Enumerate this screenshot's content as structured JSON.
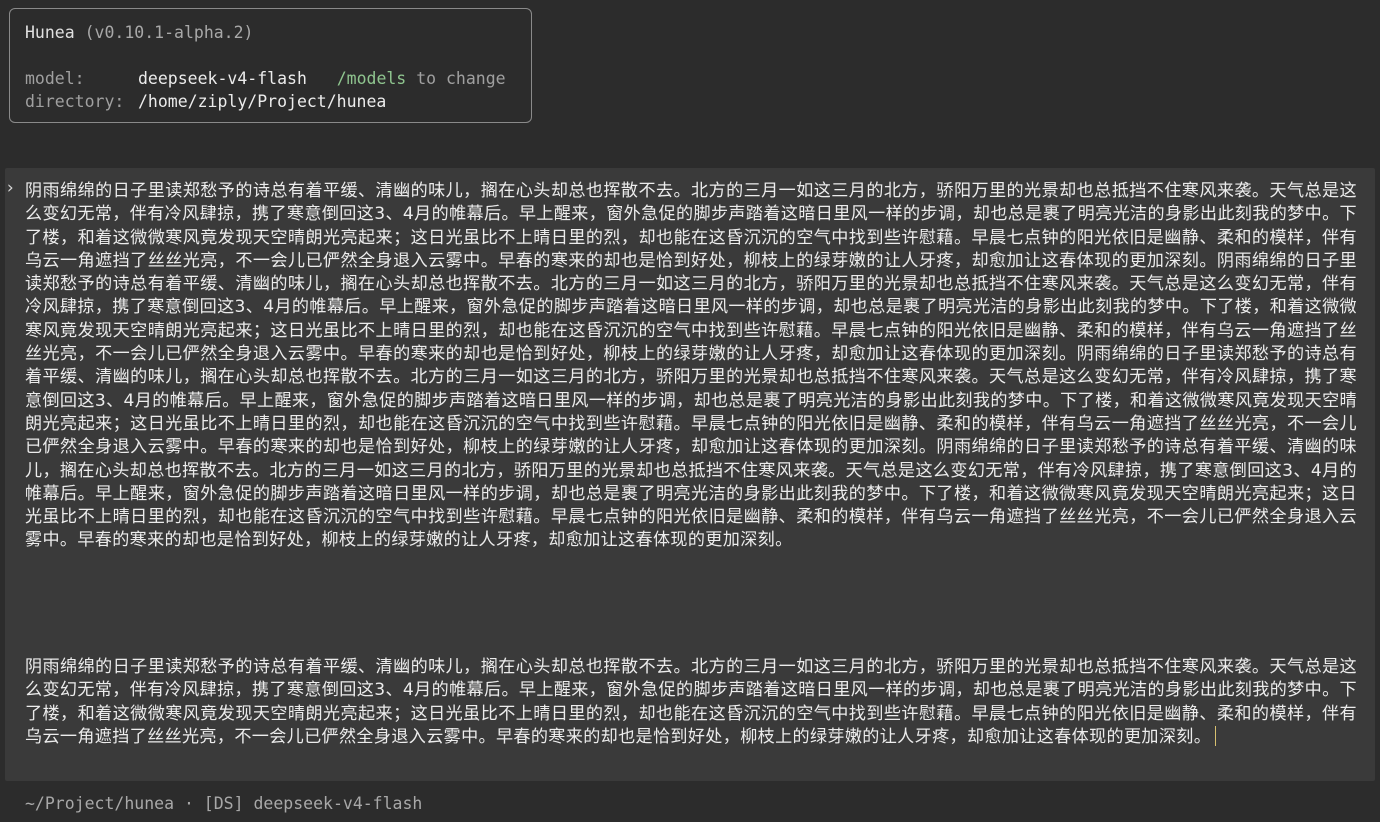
{
  "header": {
    "app_name": "Hunea",
    "version": "(v0.10.1-alpha.2)",
    "model_label": "model:",
    "model_value": "deepseek-v4-flash",
    "model_command": "/models",
    "model_hint": "to change",
    "directory_label": "directory:",
    "directory_value": "/home/ziply/Project/hunea"
  },
  "input": {
    "prompt_marker": "›",
    "paragraph_1": "阴雨绵绵的日子里读郑愁予的诗总有着平缓、清幽的味儿，搁在心头却总也挥散不去。北方的三月一如这三月的北方，骄阳万里的光景却也总抵挡不住寒风来袭。天气总是这么变幻无常，伴有冷风肆掠，携了寒意倒回这3、4月的帷幕后。早上醒来，窗外急促的脚步声踏着这暗日里风一样的步调，却也总是裹了明亮光洁的身影出此刻我的梦中。下了楼，和着这微微寒风竟发现天空晴朗光亮起来；这日光虽比不上晴日里的烈，却也能在这昏沉沉的空气中找到些许慰藉。早晨七点钟的阳光依旧是幽静、柔和的模样，伴有乌云一角遮挡了丝丝光亮，不一会儿已俨然全身退入云雾中。早春的寒来的却也是恰到好处，柳枝上的绿芽嫩的让人牙疼，却愈加让这春体现的更加深刻。阴雨绵绵的日子里读郑愁予的诗总有着平缓、清幽的味儿，搁在心头却总也挥散不去。北方的三月一如这三月的北方，骄阳万里的光景却也总抵挡不住寒风来袭。天气总是这么变幻无常，伴有冷风肆掠，携了寒意倒回这3、4月的帷幕后。早上醒来，窗外急促的脚步声踏着这暗日里风一样的步调，却也总是裹了明亮光洁的身影出此刻我的梦中。下了楼，和着这微微寒风竟发现天空晴朗光亮起来；这日光虽比不上晴日里的烈，却也能在这昏沉沉的空气中找到些许慰藉。早晨七点钟的阳光依旧是幽静、柔和的模样，伴有乌云一角遮挡了丝丝光亮，不一会儿已俨然全身退入云雾中。早春的寒来的却也是恰到好处，柳枝上的绿芽嫩的让人牙疼，却愈加让这春体现的更加深刻。阴雨绵绵的日子里读郑愁予的诗总有着平缓、清幽的味儿，搁在心头却总也挥散不去。北方的三月一如这三月的北方，骄阳万里的光景却也总抵挡不住寒风来袭。天气总是这么变幻无常，伴有冷风肆掠，携了寒意倒回这3、4月的帷幕后。早上醒来，窗外急促的脚步声踏着这暗日里风一样的步调，却也总是裹了明亮光洁的身影出此刻我的梦中。下了楼，和着这微微寒风竟发现天空晴朗光亮起来；这日光虽比不上晴日里的烈，却也能在这昏沉沉的空气中找到些许慰藉。早晨七点钟的阳光依旧是幽静、柔和的模样，伴有乌云一角遮挡了丝丝光亮，不一会儿已俨然全身退入云雾中。早春的寒来的却也是恰到好处，柳枝上的绿芽嫩的让人牙疼，却愈加让这春体现的更加深刻。阴雨绵绵的日子里读郑愁予的诗总有着平缓、清幽的味儿，搁在心头却总也挥散不去。北方的三月一如这三月的北方，骄阳万里的光景却也总抵挡不住寒风来袭。天气总是这么变幻无常，伴有冷风肆掠，携了寒意倒回这3、4月的帷幕后。早上醒来，窗外急促的脚步声踏着这暗日里风一样的步调，却也总是裹了明亮光洁的身影出此刻我的梦中。下了楼，和着这微微寒风竟发现天空晴朗光亮起来；这日光虽比不上晴日里的烈，却也能在这昏沉沉的空气中找到些许慰藉。早晨七点钟的阳光依旧是幽静、柔和的模样，伴有乌云一角遮挡了丝丝光亮，不一会儿已俨然全身退入云雾中。早春的寒来的却也是恰到好处，柳枝上的绿芽嫩的让人牙疼，却愈加让这春体现的更加深刻。",
    "paragraph_2": "阴雨绵绵的日子里读郑愁予的诗总有着平缓、清幽的味儿，搁在心头却总也挥散不去。北方的三月一如这三月的北方，骄阳万里的光景却也总抵挡不住寒风来袭。天气总是这么变幻无常，伴有冷风肆掠，携了寒意倒回这3、4月的帷幕后。早上醒来，窗外急促的脚步声踏着这暗日里风一样的步调，却也总是裹了明亮光洁的身影出此刻我的梦中。下了楼，和着这微微寒风竟发现天空晴朗光亮起来；这日光虽比不上晴日里的烈，却也能在这昏沉沉的空气中找到些许慰藉。早晨七点钟的阳光依旧是幽静、柔和的模样，伴有乌云一角遮挡了丝丝光亮，不一会儿已俨然全身退入云雾中。早春的寒来的却也是恰到好处，柳枝上的绿芽嫩的让人牙疼，却愈加让这春体现的更加深刻。"
  },
  "status": {
    "text": "~/Project/hunea · [DS] deepseek-v4-flash"
  },
  "colors": {
    "background": "#2c2c2c",
    "input_panel": "#3a3a3a",
    "command_accent": "#8fc58f",
    "cursor": "#d7c070"
  }
}
